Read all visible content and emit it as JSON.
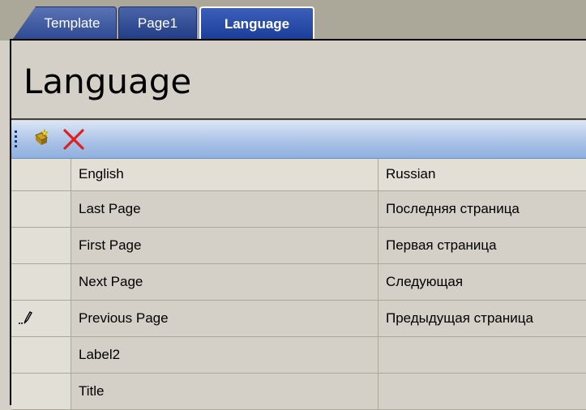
{
  "tabs": [
    {
      "label": "Template",
      "active": false
    },
    {
      "label": "Page1",
      "active": false
    },
    {
      "label": "Language",
      "active": true
    }
  ],
  "page_title": "Language",
  "toolbar": {
    "buttons": [
      {
        "icon": "new-row-icon"
      },
      {
        "icon": "delete-x-icon",
        "color": "#e02020"
      }
    ]
  },
  "grid": {
    "columns": [
      "English",
      "Russian"
    ],
    "rows": [
      {
        "english": "Last Page",
        "russian": "Последняя страница",
        "editing": false
      },
      {
        "english": "First Page",
        "russian": "Первая страница",
        "editing": false
      },
      {
        "english": "Next Page",
        "russian": "Следующая",
        "editing": false
      },
      {
        "english": "Previous Page",
        "russian": "Предыдущая страница",
        "editing": true
      },
      {
        "english": "Label2",
        "russian": "",
        "editing": false
      },
      {
        "english": "Title",
        "russian": "",
        "editing": false
      }
    ]
  },
  "colors": {
    "tab_blue": "#243e86",
    "toolbar_blue": "#a7c0e5",
    "delete_red": "#e02020",
    "frame_gray": "#d4d0c8"
  }
}
